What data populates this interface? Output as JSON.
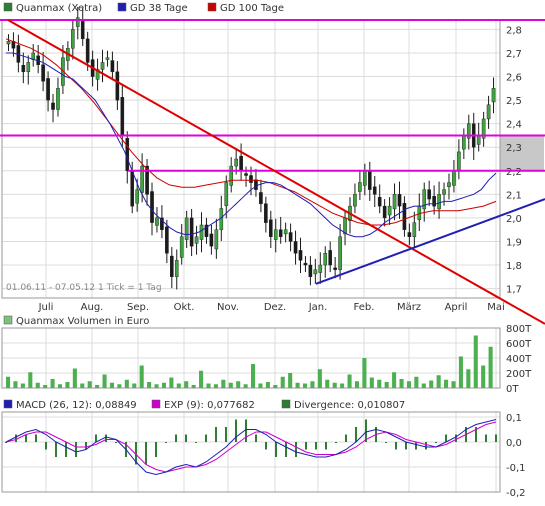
{
  "chart_data": [
    {
      "type": "candlestick",
      "legend": [
        {
          "label": "Quanmax (Xetra)",
          "color": "#2e7d32"
        },
        {
          "label": "GD 38 Tage",
          "color": "#1f1fb4"
        },
        {
          "label": "GD 100 Tage",
          "color": "#cc0000"
        }
      ],
      "x_tick_labels": [
        "Juli",
        "Aug.",
        "Sep.",
        "Okt.",
        "Nov.",
        "Dez.",
        "Jan.",
        "Feb.",
        "März",
        "April",
        "Mai"
      ],
      "y_tick_labels": [
        "2,8",
        "2,7",
        "2,6",
        "2,5",
        "2,4",
        "2,3",
        "2,2",
        "2,1",
        "2,0",
        "1,9",
        "1,8",
        "1,7"
      ],
      "ylim": [
        1.66,
        2.84
      ],
      "range_note": "01.06.11 - 07.05.12   1 Tick = 1 Tag",
      "price_close": [
        2.75,
        2.72,
        2.66,
        2.62,
        2.66,
        2.7,
        2.65,
        2.58,
        2.5,
        2.46,
        2.55,
        2.68,
        2.72,
        2.8,
        2.85,
        2.76,
        2.66,
        2.6,
        2.63,
        2.66,
        2.68,
        2.62,
        2.5,
        2.35,
        2.2,
        2.05,
        2.12,
        2.22,
        2.1,
        1.98,
        2.0,
        1.95,
        1.85,
        1.75,
        1.82,
        1.92,
        2.0,
        1.88,
        1.92,
        1.97,
        1.92,
        1.88,
        1.95,
        2.04,
        2.15,
        2.22,
        2.25,
        2.2,
        2.18,
        2.15,
        2.12,
        2.06,
        1.98,
        1.92,
        1.95,
        1.92,
        1.95,
        1.9,
        1.85,
        1.82,
        1.8,
        1.75,
        1.78,
        1.8,
        1.85,
        1.8,
        1.78,
        1.92,
        2.0,
        2.05,
        2.1,
        2.15,
        2.2,
        2.12,
        2.1,
        2.05,
        2.0,
        2.05,
        2.1,
        2.05,
        1.95,
        1.92,
        1.98,
        2.05,
        2.12,
        2.08,
        2.05,
        2.1,
        2.12,
        2.15,
        2.2,
        2.28,
        2.35,
        2.4,
        2.3,
        2.35,
        2.42,
        2.48,
        2.55
      ],
      "ma_38_days": [
        2.7,
        2.7,
        2.69,
        2.68,
        2.67,
        2.66,
        2.64,
        2.62,
        2.6,
        2.59,
        2.56,
        2.53,
        2.5,
        2.45,
        2.4,
        2.34,
        2.28,
        2.2,
        2.12,
        2.06,
        2.02,
        1.99,
        1.96,
        1.94,
        1.93,
        1.93,
        1.94,
        1.96,
        1.98,
        2.0,
        2.03,
        2.06,
        2.09,
        2.12,
        2.14,
        2.15,
        2.15,
        2.14,
        2.12,
        2.1,
        2.08,
        2.06,
        2.03,
        2.0,
        1.97,
        1.95,
        1.93,
        1.92,
        1.92,
        1.93,
        1.95,
        1.98,
        2.0,
        2.02,
        2.04,
        2.05,
        2.05,
        2.06,
        2.06,
        2.07,
        2.07,
        2.08,
        2.09,
        2.1,
        2.12,
        2.16,
        2.19
      ],
      "ma_100_days": [
        2.76,
        2.74,
        2.72,
        2.69,
        2.65,
        2.6,
        2.55,
        2.49,
        2.42,
        2.35,
        2.28,
        2.22,
        2.17,
        2.14,
        2.13,
        2.13,
        2.14,
        2.15,
        2.16,
        2.16,
        2.16,
        2.15,
        2.13,
        2.11,
        2.08,
        2.05,
        2.02,
        2.0,
        1.98,
        1.97,
        1.97,
        1.98,
        2.0,
        2.02,
        2.03,
        2.03,
        2.03,
        2.04,
        2.05,
        2.07
      ],
      "trendline_down": {
        "from": [
          0,
          2.84
        ],
        "to": [
          1,
          1.66
        ]
      },
      "trendline_up": {
        "from": [
          0,
          1.72
        ],
        "to": [
          1,
          2.08
        ]
      },
      "horizontal_lines": [
        2.84,
        2.35,
        2.2
      ]
    },
    {
      "type": "bar",
      "title": "Quanmax Volumen in Euro",
      "y_tick_labels": [
        "800T",
        "600T",
        "400T",
        "200T",
        "0T"
      ],
      "ylim": [
        0,
        800000
      ],
      "values": [
        150000,
        90000,
        60000,
        210000,
        70000,
        40000,
        120000,
        50000,
        80000,
        260000,
        60000,
        90000,
        40000,
        180000,
        70000,
        50000,
        110000,
        60000,
        300000,
        80000,
        50000,
        70000,
        140000,
        60000,
        90000,
        40000,
        230000,
        60000,
        50000,
        110000,
        70000,
        90000,
        50000,
        320000,
        60000,
        80000,
        40000,
        150000,
        200000,
        70000,
        60000,
        90000,
        250000,
        110000,
        70000,
        60000,
        180000,
        90000,
        400000,
        140000,
        110000,
        80000,
        210000,
        120000,
        90000,
        150000,
        60000,
        100000,
        170000,
        110000,
        90000,
        420000,
        250000,
        700000,
        300000,
        550000
      ]
    },
    {
      "type": "line",
      "legend": [
        {
          "label": "MACD (26, 12): 0,08849",
          "color": "#1f1fb4"
        },
        {
          "label": "EXP (9): 0,077682",
          "color": "#cc00cc"
        },
        {
          "label": "Divergence: 0,010807",
          "color": "#2e7d32"
        }
      ],
      "y_tick_labels": [
        "0,1",
        "0,0",
        "-0,1",
        "-0,2"
      ],
      "ylim": [
        -0.2,
        0.12
      ],
      "macd": [
        0.0,
        0.02,
        0.04,
        0.05,
        0.03,
        0.0,
        -0.02,
        -0.04,
        -0.03,
        0.0,
        0.02,
        0.01,
        -0.03,
        -0.08,
        -0.12,
        -0.13,
        -0.12,
        -0.1,
        -0.09,
        -0.1,
        -0.08,
        -0.05,
        -0.02,
        0.02,
        0.05,
        0.05,
        0.03,
        0.0,
        -0.02,
        -0.04,
        -0.05,
        -0.06,
        -0.06,
        -0.05,
        -0.03,
        0.0,
        0.04,
        0.05,
        0.04,
        0.02,
        0.0,
        -0.01,
        -0.02,
        -0.02,
        0.0,
        0.02,
        0.05,
        0.07,
        0.08,
        0.09
      ],
      "signal": [
        0.0,
        0.01,
        0.03,
        0.04,
        0.04,
        0.02,
        0.0,
        -0.02,
        -0.02,
        -0.01,
        0.01,
        0.01,
        -0.01,
        -0.05,
        -0.09,
        -0.11,
        -0.12,
        -0.11,
        -0.1,
        -0.1,
        -0.09,
        -0.07,
        -0.04,
        -0.01,
        0.02,
        0.04,
        0.04,
        0.02,
        0.0,
        -0.02,
        -0.04,
        -0.05,
        -0.05,
        -0.05,
        -0.04,
        -0.02,
        0.01,
        0.03,
        0.04,
        0.03,
        0.01,
        0.0,
        -0.01,
        -0.02,
        -0.01,
        0.01,
        0.03,
        0.05,
        0.07,
        0.08
      ]
    }
  ]
}
